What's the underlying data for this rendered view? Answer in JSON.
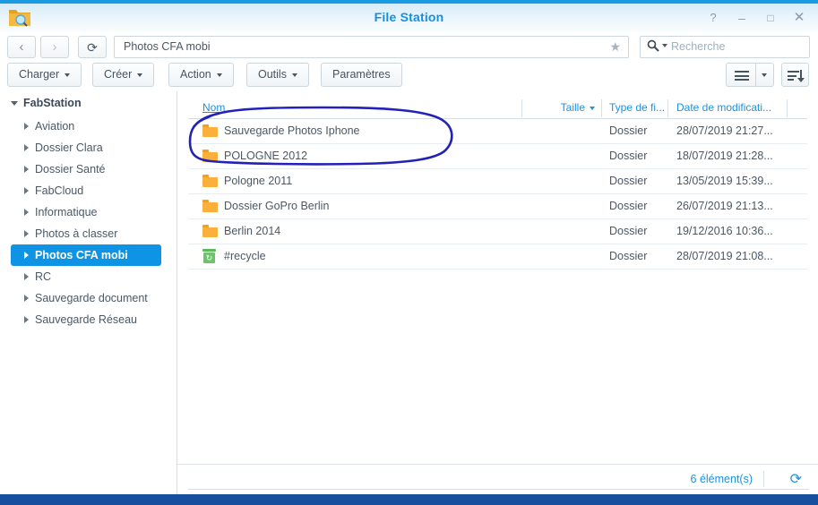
{
  "window": {
    "title": "File Station",
    "app_icon": "folder-search-icon",
    "controls": {
      "help": "?",
      "minimize": "–",
      "maximize": "□",
      "close": "✕"
    }
  },
  "nav": {
    "back_icon": "chevron-left-icon",
    "back_label": "‹",
    "forward_icon": "chevron-right-icon",
    "forward_label": "›",
    "reload_icon": "reload-icon",
    "reload_label": "⟳",
    "address_value": "Photos CFA mobi",
    "favorite_icon": "star-icon",
    "favorite_label": "★"
  },
  "search": {
    "icon": "magnifier-icon",
    "placeholder": "Recherche",
    "value": ""
  },
  "toolbar": {
    "charger_label": "Charger",
    "creer_label": "Créer",
    "action_label": "Action",
    "outils_label": "Outils",
    "parametres_label": "Paramètres",
    "view_icon": "list-view-icon",
    "view_caret_icon": "chevron-down-icon",
    "sort_icon": "sort-descending-icon"
  },
  "sidebar": {
    "root_label": "FabStation",
    "items": [
      {
        "label": "Aviation",
        "selected": false
      },
      {
        "label": "Dossier Clara",
        "selected": false
      },
      {
        "label": "Dossier Santé",
        "selected": false
      },
      {
        "label": "FabCloud",
        "selected": false
      },
      {
        "label": "Informatique",
        "selected": false
      },
      {
        "label": "Photos à classer",
        "selected": false
      },
      {
        "label": "Photos CFA mobi",
        "selected": true
      },
      {
        "label": "RC",
        "selected": false
      },
      {
        "label": "Sauvegarde document",
        "selected": false
      },
      {
        "label": "Sauvegarde Réseau",
        "selected": false
      }
    ]
  },
  "filelist": {
    "columns": {
      "name": "Nom",
      "size": "Taille",
      "type": "Type de fi...",
      "modified": "Date de modificati...",
      "options_icon": "more-options-icon"
    },
    "rows": [
      {
        "name": "Sauvegarde Photos Iphone",
        "icon": "folder-icon",
        "size": "",
        "type": "Dossier",
        "modified": "28/07/2019 21:27..."
      },
      {
        "name": "POLOGNE 2012",
        "icon": "folder-icon",
        "size": "",
        "type": "Dossier",
        "modified": "18/07/2019 21:28..."
      },
      {
        "name": "Pologne 2011",
        "icon": "folder-icon",
        "size": "",
        "type": "Dossier",
        "modified": "13/05/2019 15:39..."
      },
      {
        "name": "Dossier GoPro Berlin",
        "icon": "folder-icon",
        "size": "",
        "type": "Dossier",
        "modified": "26/07/2019 21:13..."
      },
      {
        "name": "Berlin 2014",
        "icon": "folder-icon",
        "size": "",
        "type": "Dossier",
        "modified": "19/12/2016 10:36..."
      },
      {
        "name": "#recycle",
        "icon": "recycle-bin-icon",
        "size": "",
        "type": "Dossier",
        "modified": "28/07/2019 21:08..."
      }
    ]
  },
  "status": {
    "count_label": "6 élément(s)",
    "refresh_icon": "refresh-icon",
    "refresh_label": "⟳"
  },
  "annotation": {
    "shape": "hand-drawn-ellipse",
    "color": "#2222bb"
  },
  "colors": {
    "accent_blue": "#2091e0",
    "selection_blue": "#0e93e5",
    "folder_orange": "#fbb03b",
    "recycle_green": "#5cb85c",
    "taskbar_blue": "#174f9e",
    "annotation_blue": "#2222bb"
  }
}
